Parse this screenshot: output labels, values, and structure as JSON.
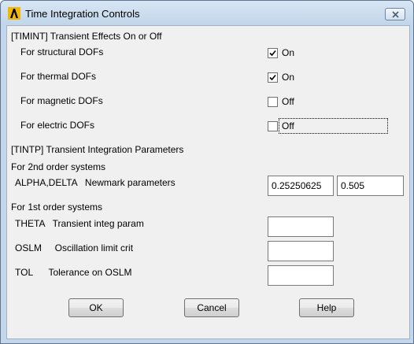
{
  "window": {
    "title": "Time Integration Controls",
    "app_icon": "ansys-logo-icon",
    "close_icon": "close-icon"
  },
  "timint": {
    "section_label": "[TIMINT]  Transient Effects On or Off",
    "rows": [
      {
        "label": "For structural DOFs",
        "checked": true,
        "state_text": "On"
      },
      {
        "label": "For thermal DOFs",
        "checked": true,
        "state_text": "On"
      },
      {
        "label": "For magnetic DOFs",
        "checked": false,
        "state_text": "Off"
      },
      {
        "label": "For electric DOFs",
        "checked": false,
        "state_text": "Off"
      }
    ]
  },
  "tintp": {
    "section_label": "[TINTP]  Transient Integration Parameters",
    "second_order_label": "For 2nd order systems",
    "alpha_delta": {
      "label": "ALPHA,DELTA   Newmark parameters",
      "alpha_value": "0.25250625",
      "delta_value": "0.505"
    },
    "first_order_label": "For 1st order systems",
    "theta": {
      "label": "THETA   Transient integ param",
      "value": ""
    },
    "oslm": {
      "label": "OSLM     Oscillation limit crit",
      "value": ""
    },
    "tol": {
      "label": "TOL      Tolerance on OSLM",
      "value": ""
    }
  },
  "buttons": {
    "ok": "OK",
    "cancel": "Cancel",
    "help": "Help"
  },
  "colors": {
    "frame": "#c4d7ea",
    "client": "#f0f0f0",
    "icon_yellow": "#f2b705"
  }
}
